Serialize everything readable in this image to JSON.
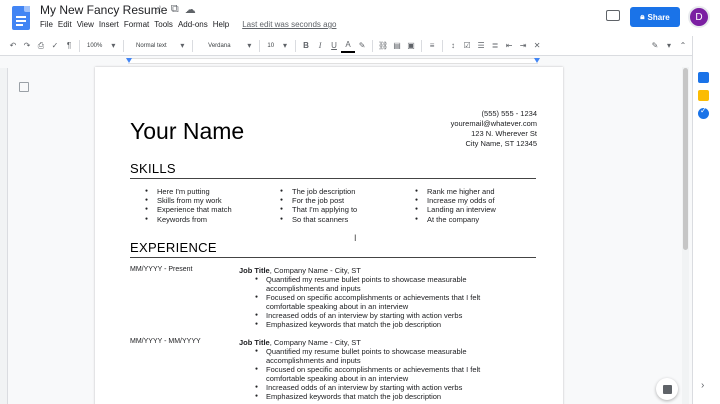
{
  "doc": {
    "title": "My New Fancy Resume",
    "title_icons": [
      "star-icon",
      "move-folder-icon",
      "cloud-saved-icon"
    ]
  },
  "menu": {
    "items": [
      "File",
      "Edit",
      "View",
      "Insert",
      "Format",
      "Tools",
      "Add-ons",
      "Help"
    ],
    "last_edit": "Last edit was seconds ago"
  },
  "header_right": {
    "share_label": "Share",
    "avatar_letter": "D",
    "share_color": "#1a73e8"
  },
  "toolbar": {
    "zoom": "100%",
    "style": "Normal text",
    "font": "Verdana",
    "size": "10",
    "bold": "B",
    "italic": "I",
    "underline": "U",
    "text_color": "A"
  },
  "resume": {
    "name": "Your Name",
    "contact": [
      "(555) 555 - 1234",
      "youremail@whatever.com",
      "123 N. Wherever St",
      "City Name, ST 12345"
    ],
    "skills_title": "SKILLS",
    "skills_columns": [
      [
        "Here I'm putting",
        "Skills from my work",
        "Experience that match",
        "Keywords from"
      ],
      [
        "The job description",
        "For the job post",
        "That I'm applying to",
        "So that scanners"
      ],
      [
        "Rank me higher and",
        "Increase my odds of",
        "Landing an interview",
        "At the company"
      ]
    ],
    "experience_title": "EXPERIENCE",
    "jobs": [
      {
        "dates": "MM/YYYY - Present",
        "title": "Job Title",
        "company": ", Company Name - City, ST",
        "bullets": [
          "Quantified my resume bullet points to showcase measurable accomplishments and inputs",
          "Focused on specific accomplishments or achievements that I felt comfortable speaking about in an interview",
          "Increased odds of an interview by starting with action verbs",
          "Emphasized keywords that match the job description"
        ]
      },
      {
        "dates": "MM/YYYY - MM/YYYY",
        "title": "Job Title",
        "company": ", Company Name - City, ST",
        "bullets": [
          "Quantified my resume bullet points to showcase measurable accomplishments and inputs",
          "Focused on specific accomplishments or achievements that I felt comfortable speaking about in an interview",
          "Increased odds of an interview by starting with action verbs",
          "Emphasized keywords that match the job description"
        ]
      }
    ]
  }
}
